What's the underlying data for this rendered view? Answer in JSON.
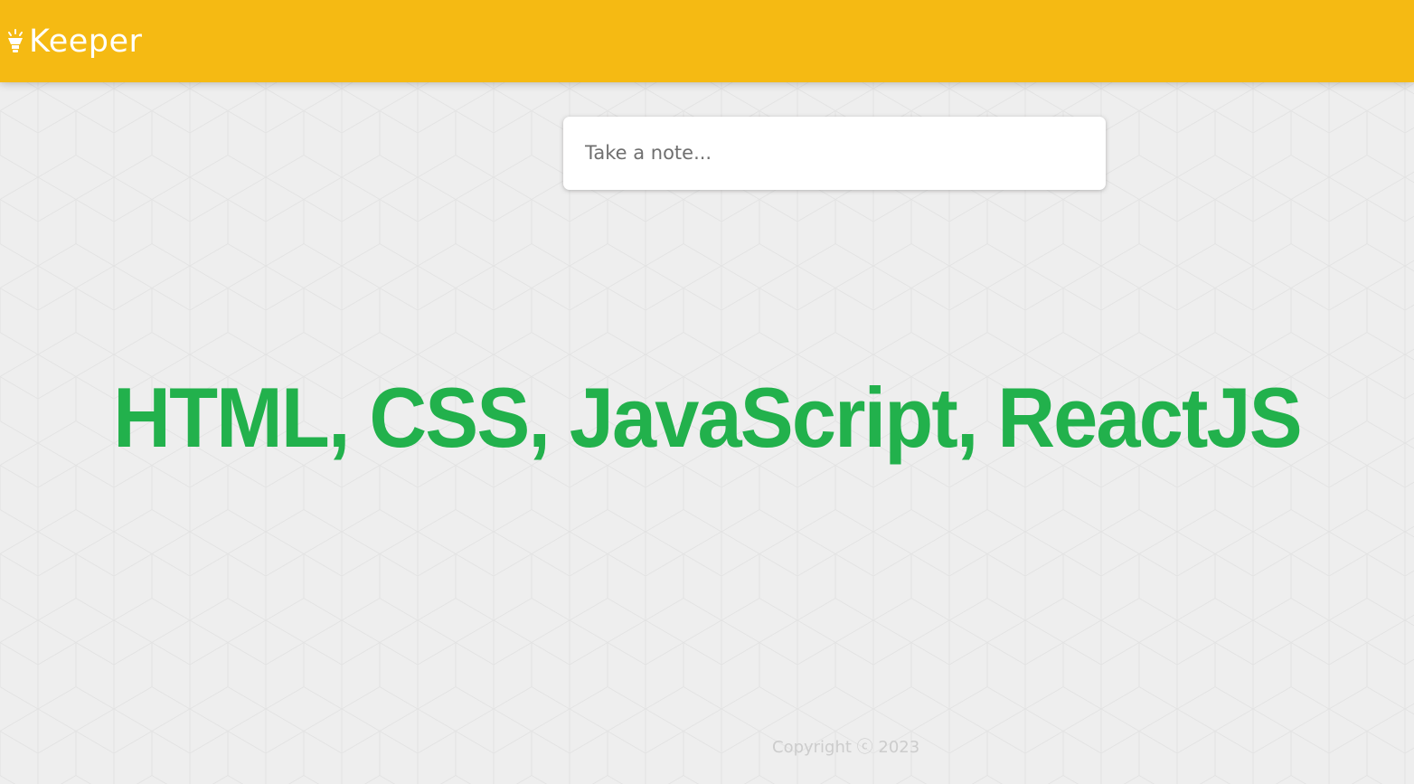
{
  "app": {
    "title": "Keeper",
    "logo_icon": "lightbulb-icon",
    "brand_color": "#f5ba13"
  },
  "note_form": {
    "placeholder": "Take a note...",
    "value": ""
  },
  "hero": {
    "text": "HTML, CSS, JavaScript, ReactJS",
    "color": "#22b14c"
  },
  "footer": {
    "text": "Copyright ⓒ 2023"
  }
}
